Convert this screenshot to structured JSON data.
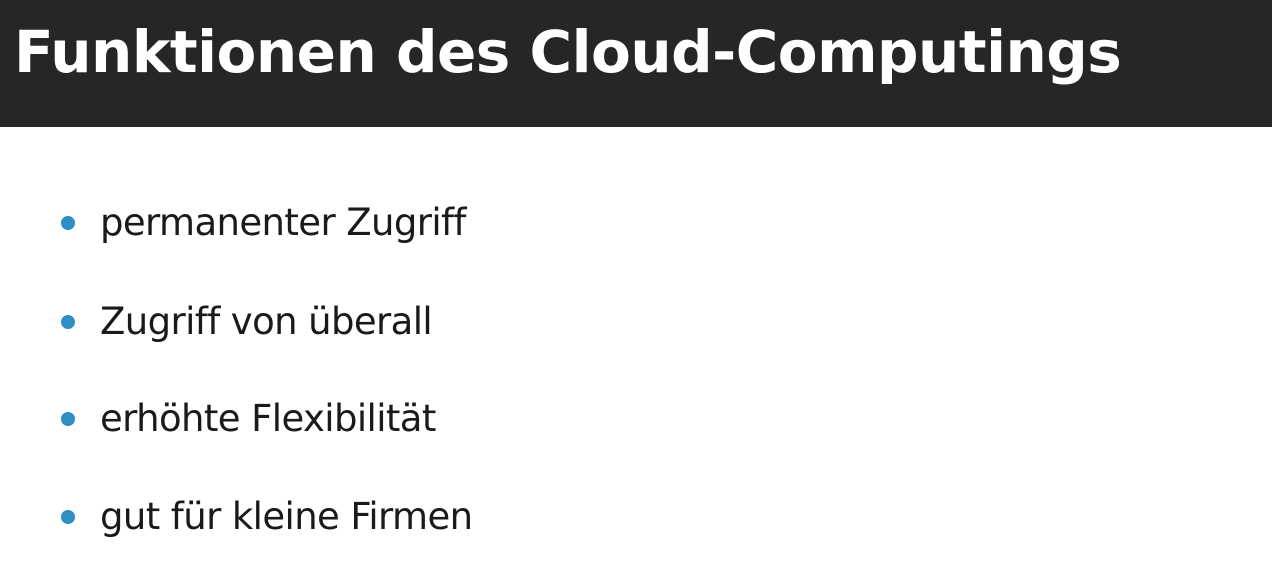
{
  "slide": {
    "title": "Funktionen des Cloud-Computings",
    "bullets": [
      "permanenter Zugriff",
      "Zugriff von überall",
      "erhöhte Flexibilität",
      "gut für kleine Firmen"
    ]
  },
  "colors": {
    "title_bar": "#262626",
    "title_text": "#ffffff",
    "bullet_dot": "#2e8fc4",
    "body_text": "#1a1a1a"
  }
}
